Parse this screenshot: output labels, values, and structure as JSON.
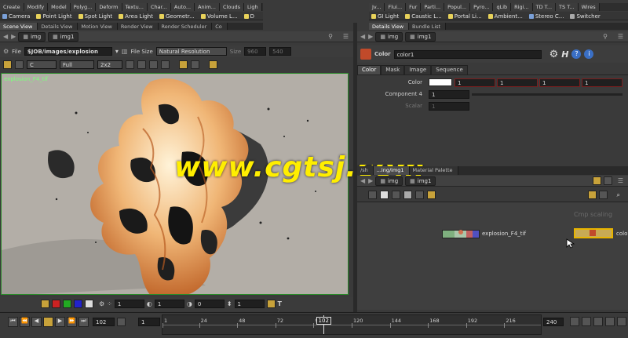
{
  "shelf_left": [
    "Create",
    "Modify",
    "Model",
    "Polyg...",
    "Deform",
    "Textu...",
    "Char...",
    "Auto...",
    "Anim...",
    "Clouds",
    "Ligh"
  ],
  "shelf_right": [
    "Jv...",
    "Flui...",
    "Fur",
    "Parti...",
    "Popul...",
    "Pyro...",
    "qLib",
    "Rigi...",
    "TD T...",
    "TS T...",
    "Wires"
  ],
  "tools_left": [
    {
      "label": "Camera",
      "icon": "camera-icon",
      "color": "#7aa0d8"
    },
    {
      "label": "Point Light",
      "icon": "point-light-icon",
      "color": "#e8d25a"
    },
    {
      "label": "Spot Light",
      "icon": "spot-light-icon",
      "color": "#e8d25a"
    },
    {
      "label": "Area Light",
      "icon": "area-light-icon",
      "color": "#e8d25a"
    },
    {
      "label": "Geometr...",
      "icon": "geometry-light-icon",
      "color": "#e8d25a"
    },
    {
      "label": "Volume L...",
      "icon": "volume-light-icon",
      "color": "#e8d25a"
    },
    {
      "label": "D",
      "icon": "distant-light-icon",
      "color": "#e8d25a"
    }
  ],
  "tools_right": [
    {
      "label": "GI Light",
      "icon": "gi-light-icon",
      "color": "#e8d25a"
    },
    {
      "label": "Caustic L...",
      "icon": "caustic-light-icon",
      "color": "#e8d25a"
    },
    {
      "label": "Portal Li...",
      "icon": "portal-light-icon",
      "color": "#e8d25a"
    },
    {
      "label": "Ambient...",
      "icon": "ambient-light-icon",
      "color": "#e8d25a"
    },
    {
      "label": "Stereo C...",
      "icon": "stereo-camera-icon",
      "color": "#7aa0d8"
    },
    {
      "label": "Switcher",
      "icon": "switcher-icon",
      "color": "#aaaaaa"
    }
  ],
  "left_tabs": [
    "Scene View",
    "Details View",
    "Motion View",
    "Render View",
    "Render Scheduler",
    "Co"
  ],
  "right_tabs": [
    "Details View",
    "Bundle List"
  ],
  "left_path": {
    "context": "img",
    "node": "img1"
  },
  "right_path": {
    "context": "img",
    "node": "img1"
  },
  "viewer_toolbar": {
    "file_label": "File",
    "file_path": "$JOB/images/explosion",
    "file_size_label": "File Size",
    "resolution": "Natural Resolution",
    "size_label": "Size",
    "size_w": "960",
    "size_h": "540",
    "channel": "C",
    "quality": "Full",
    "grid": "2x2"
  },
  "viewer": {
    "image_name": "explosion_F4_tif"
  },
  "viewer_bottom": {
    "v1": "1",
    "v2": "1",
    "v3": "0",
    "v4": "1"
  },
  "params": {
    "node_type": "Color",
    "node_name": "color1",
    "tabs": [
      "Color",
      "Mask",
      "Image",
      "Sequence"
    ],
    "color_label": "Color",
    "color_values": [
      "1",
      "1",
      "1",
      "1"
    ],
    "component_label": "Component 4",
    "component_value": "1",
    "scalar_label": "Scalar",
    "scalar_value": "1"
  },
  "network_tabs": [
    "/sh",
    "...ing/img1",
    "Material Palette"
  ],
  "network_path": {
    "context": "img",
    "node": "img1"
  },
  "network": {
    "node1_label": "explosion_F4_tif",
    "node2_label": "color",
    "hint": "Cmp scaling"
  },
  "timeline": {
    "start": "1",
    "end": "240",
    "current_frame": "102",
    "step": "1",
    "ticks": [
      "1",
      "24",
      "48",
      "72",
      "96",
      "120",
      "144",
      "168",
      "192",
      "216"
    ]
  },
  "watermark": "www.cgtsj.com",
  "colors": {
    "accent": "#e8b400",
    "viewer_border": "#2a8a2a",
    "watermark": "#ffee00"
  }
}
